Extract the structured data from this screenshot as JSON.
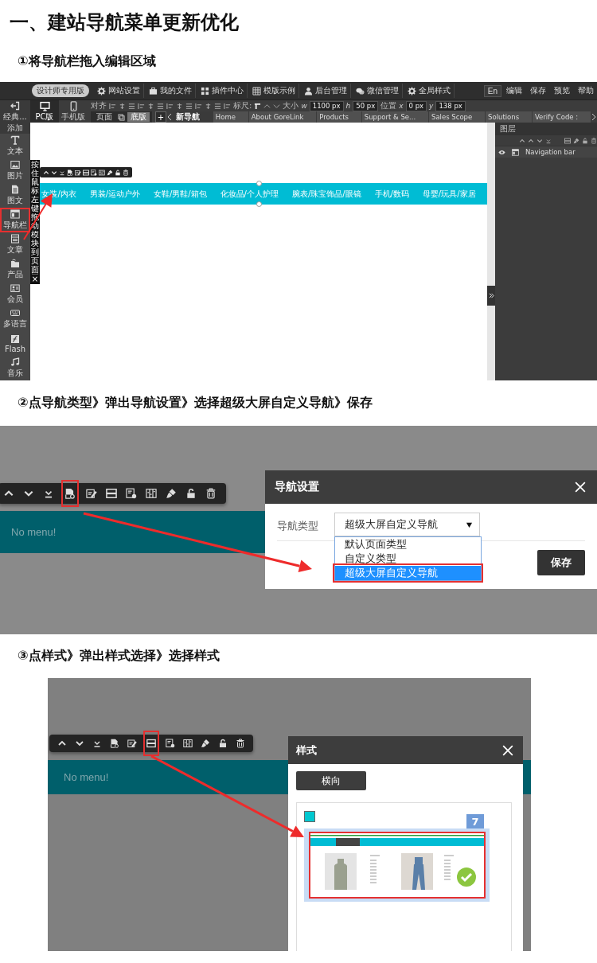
{
  "title": "一、建站导航菜单更新优化",
  "steps": [
    {
      "caption": "①将导航栏拖入编辑区域"
    },
    {
      "caption": "②点导航类型》弹出导航设置》选择超级大屏自定义导航》保存"
    },
    {
      "caption": "③点样式》弹出样式选择》选择样式"
    }
  ],
  "editor": {
    "top_menu": [
      {
        "kind": "badge",
        "label": "设计师专用版"
      },
      {
        "kind": "gear",
        "label": "网站设置"
      },
      {
        "kind": "briefcase",
        "label": "我的文件"
      },
      {
        "kind": "puzzle",
        "label": "插件中心"
      },
      {
        "kind": "grid",
        "label": "模版示例"
      },
      {
        "kind": "person",
        "label": "后台管理"
      },
      {
        "kind": "chat",
        "label": "微信管理"
      },
      {
        "kind": "gear",
        "label": "全局样式"
      }
    ],
    "lang": "En",
    "right_menu": [
      "编辑",
      "保存",
      "预览",
      "帮助"
    ],
    "exit_label": "经典...",
    "devices": [
      {
        "kind": "monitor",
        "label": "PC版",
        "selected": true
      },
      {
        "kind": "phone",
        "label": "手机版",
        "selected": false
      }
    ],
    "align_label": "对齐",
    "ruler_label": "标尺:",
    "size_label": "大小",
    "position_label": "位置",
    "fields": [
      {
        "label": "w",
        "value": "1100",
        "unit": "px"
      },
      {
        "label": "h",
        "value": "50",
        "unit": "px"
      },
      {
        "label": "x",
        "value": "0",
        "unit": "px"
      },
      {
        "label": "y",
        "value": "138",
        "unit": "px"
      }
    ],
    "page_tabs": [
      {
        "label": "页面",
        "selected": false
      },
      {
        "label": "底版",
        "selected": true
      }
    ],
    "add": "+",
    "page_nav": [
      {
        "label": "新导航",
        "selected": true
      },
      {
        "label": "Home",
        "selected": false
      },
      {
        "label": "About GoreLink",
        "selected": false
      },
      {
        "label": "Products",
        "selected": false
      },
      {
        "label": "Support & Se...",
        "selected": false
      },
      {
        "label": "Sales Scope",
        "selected": false
      },
      {
        "label": "Solutions",
        "selected": false
      },
      {
        "label": "Verify Code :",
        "selected": false
      }
    ],
    "sidebar_header": "添加",
    "sidebar": [
      {
        "kind": "text",
        "label": "文本",
        "highlighted": false
      },
      {
        "kind": "image",
        "label": "图片",
        "highlighted": false
      },
      {
        "kind": "doc",
        "label": "图文",
        "highlighted": false
      },
      {
        "kind": "navbar",
        "label": "导航栏",
        "highlighted": true
      },
      {
        "kind": "article",
        "label": "文章",
        "highlighted": false
      },
      {
        "kind": "product",
        "label": "产品",
        "highlighted": false
      },
      {
        "kind": "member",
        "label": "会员",
        "highlighted": false
      },
      {
        "kind": "keyboard",
        "label": "多语言",
        "highlighted": false
      },
      {
        "kind": "flash",
        "label": "Flash",
        "highlighted": false
      },
      {
        "kind": "music",
        "label": "音乐",
        "highlighted": false
      }
    ],
    "drag_hint": "按住鼠标左键拖动模块到页面",
    "drag_close": "×",
    "toolbar": [
      {
        "kind": "up"
      },
      {
        "kind": "down"
      },
      {
        "kind": "bottom"
      },
      {
        "kind": "navtype"
      },
      {
        "kind": "edit"
      },
      {
        "kind": "style"
      },
      {
        "kind": "settings"
      },
      {
        "kind": "columns"
      },
      {
        "kind": "brush"
      },
      {
        "kind": "lock"
      },
      {
        "kind": "trash"
      }
    ],
    "nav_items": [
      "女装/内衣",
      "男装/运动户外",
      "女鞋/男鞋/箱包",
      "化妆品/个人护理",
      "腕表/珠宝饰品/眼镜",
      "手机/数码",
      "母婴/玩具/家居"
    ],
    "layers_title": "图层",
    "layers": [
      {
        "label": "Navigation bar"
      }
    ]
  },
  "nav_settings_shot": {
    "toolbar": [
      {
        "kind": "up",
        "highlighted": false
      },
      {
        "kind": "down",
        "highlighted": false
      },
      {
        "kind": "bottom",
        "highlighted": false
      },
      {
        "kind": "navtype",
        "highlighted": true
      },
      {
        "kind": "edit",
        "highlighted": false
      },
      {
        "kind": "style",
        "highlighted": false
      },
      {
        "kind": "settings",
        "highlighted": false
      },
      {
        "kind": "columns",
        "highlighted": false
      },
      {
        "kind": "brush",
        "highlighted": false
      },
      {
        "kind": "lock",
        "highlighted": false
      },
      {
        "kind": "trash",
        "highlighted": false
      }
    ],
    "bar_text": "No menu!",
    "dialog": {
      "title": "导航设置",
      "field_label": "导航类型",
      "value": "超级大屏自定义导航",
      "options": [
        {
          "label": "默认页面类型",
          "selected": false
        },
        {
          "label": "自定义类型",
          "selected": false
        },
        {
          "label": "超级大屏自定义导航",
          "selected": true
        }
      ],
      "save": "保存"
    }
  },
  "style_shot": {
    "toolbar": [
      {
        "kind": "up",
        "highlighted": false
      },
      {
        "kind": "down",
        "highlighted": false
      },
      {
        "kind": "bottom",
        "highlighted": false
      },
      {
        "kind": "navtype",
        "highlighted": false
      },
      {
        "kind": "edit",
        "highlighted": false
      },
      {
        "kind": "style",
        "highlighted": true
      },
      {
        "kind": "settings",
        "highlighted": false
      },
      {
        "kind": "columns",
        "highlighted": false
      },
      {
        "kind": "brush",
        "highlighted": false
      },
      {
        "kind": "lock",
        "highlighted": false
      },
      {
        "kind": "trash",
        "highlighted": false
      }
    ],
    "bar_text": "No menu!",
    "dialog": {
      "title": "样式",
      "tab": "横向",
      "number": "7"
    }
  }
}
